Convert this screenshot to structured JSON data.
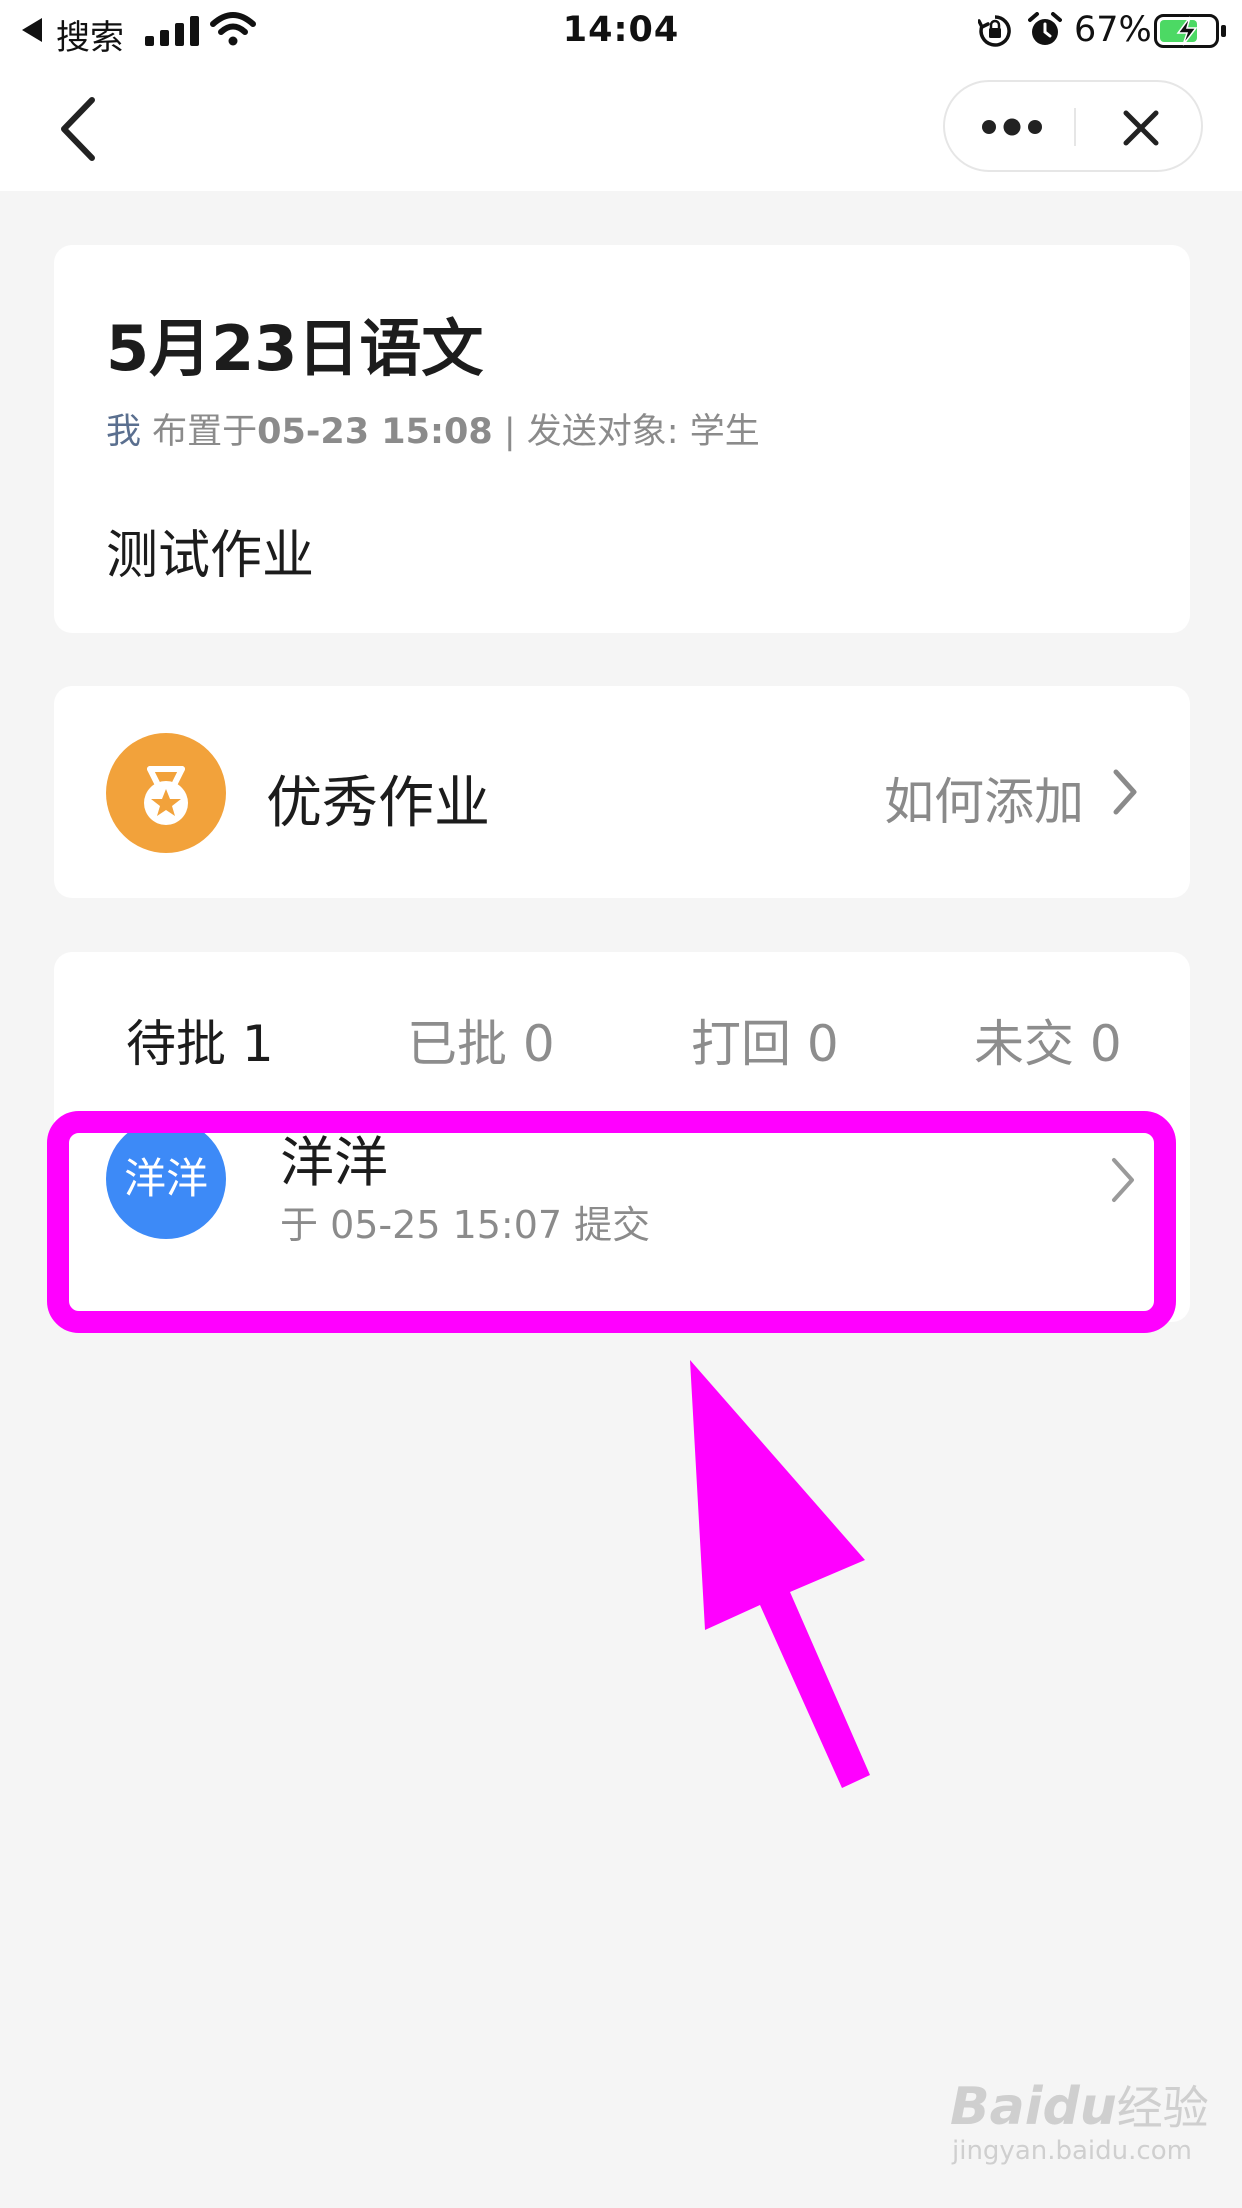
{
  "status_bar": {
    "back_app": "搜索",
    "time": "14:04",
    "battery": "67%"
  },
  "homework": {
    "title": "5月23日语文",
    "meta_me": "我",
    "meta_assigned_prefix": "布置于",
    "meta_datetime": "05-23 15:08",
    "meta_separator": "|",
    "meta_target": "发送对象: 学生",
    "description": "测试作业"
  },
  "excellent": {
    "label": "优秀作业",
    "link": "如何添加"
  },
  "tabs": [
    {
      "label": "待批 1"
    },
    {
      "label": "已批 0"
    },
    {
      "label": "打回 0"
    },
    {
      "label": "未交 0"
    }
  ],
  "submissions": [
    {
      "avatar_text": "洋洋",
      "name": "洋洋",
      "submitted": "于 05-25 15:07 提交"
    }
  ],
  "watermark": {
    "brand_latin": "Baidu",
    "brand_cn": "经验",
    "url": "jingyan.baidu.com"
  },
  "colors": {
    "highlight": "#ff00ff",
    "avatar": "#3d8af7",
    "medal": "#f2a23b",
    "battery_fill": "#4cd964"
  },
  "icons": {
    "back": "chevron-left-icon",
    "more": "more-dots-icon",
    "close": "close-icon",
    "medal": "medal-icon",
    "row_arrow": "chevron-right-icon"
  }
}
